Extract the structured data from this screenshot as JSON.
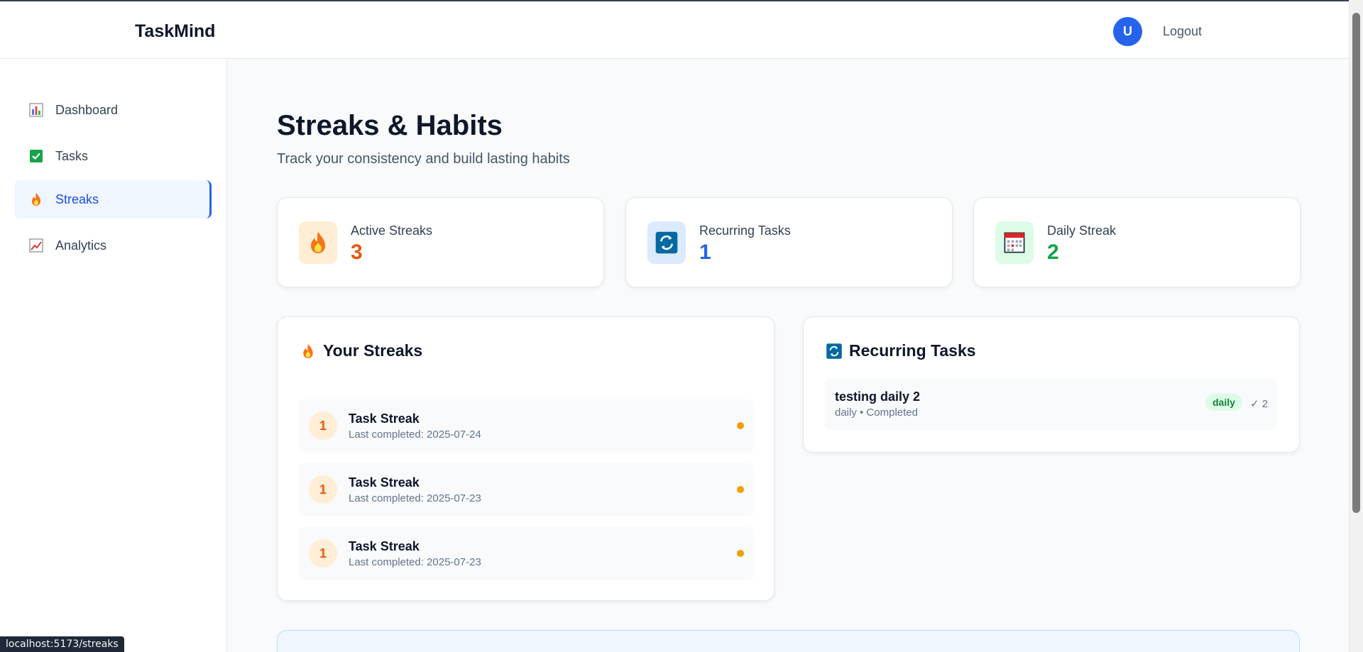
{
  "app": {
    "brand": "TaskMind",
    "avatar_initial": "U",
    "logout_label": "Logout"
  },
  "sidebar": {
    "items": [
      {
        "label": "Dashboard",
        "icon": "bar-chart-icon"
      },
      {
        "label": "Tasks",
        "icon": "check-box-icon"
      },
      {
        "label": "Streaks",
        "icon": "fire-icon",
        "active": true
      },
      {
        "label": "Analytics",
        "icon": "trend-chart-icon"
      }
    ]
  },
  "page": {
    "title": "Streaks & Habits",
    "subtitle": "Track your consistency and build lasting habits"
  },
  "stats": [
    {
      "label": "Active Streaks",
      "value": "3",
      "icon": "fire-icon",
      "color": "#ea580c"
    },
    {
      "label": "Recurring Tasks",
      "value": "1",
      "icon": "repeat-icon",
      "color": "#2563eb"
    },
    {
      "label": "Daily Streak",
      "value": "2",
      "icon": "calendar-icon",
      "color": "#16a34a"
    }
  ],
  "streaks_card": {
    "title": "Your Streaks",
    "items": [
      {
        "count": "1",
        "title": "Task Streak",
        "detail": "Last completed: 2025-07-24"
      },
      {
        "count": "1",
        "title": "Task Streak",
        "detail": "Last completed: 2025-07-23"
      },
      {
        "count": "1",
        "title": "Task Streak",
        "detail": "Last completed: 2025-07-23"
      }
    ]
  },
  "recurring_card": {
    "title": "Recurring Tasks",
    "items": [
      {
        "title": "testing daily 2",
        "detail": "daily • Completed",
        "badge": "daily",
        "count": "✓ 2"
      }
    ]
  },
  "statusbar": {
    "url": "localhost:5173/streaks"
  }
}
